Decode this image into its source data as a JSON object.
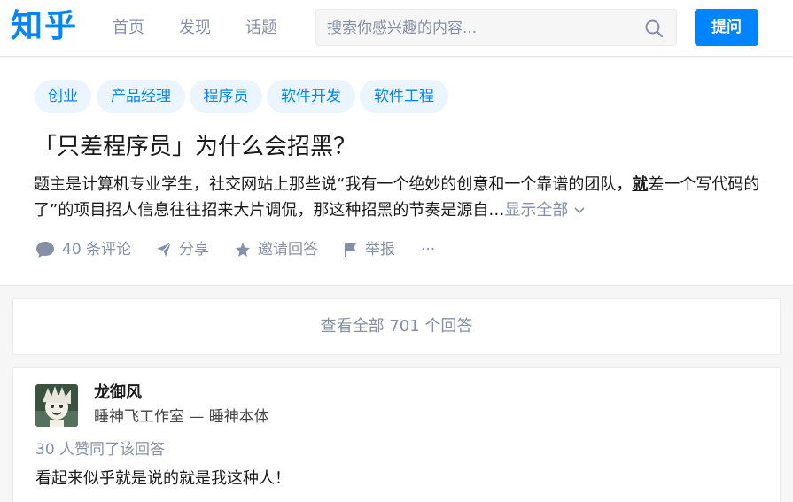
{
  "header": {
    "logo": "知乎",
    "nav": [
      "首页",
      "发现",
      "话题"
    ],
    "search_placeholder": "搜索你感兴趣的内容...",
    "ask_label": "提问",
    "accent_color": "#0084ff"
  },
  "question": {
    "topics": [
      "创业",
      "产品经理",
      "程序员",
      "软件开发",
      "软件工程"
    ],
    "title": "「只差程序员」为什么会招黑？",
    "desc_part1": "题主是计算机专业学生，社交网站上那些说“我有一个绝妙的创意和一个靠谱的团队，",
    "desc_highlight": "就",
    "desc_part2": "差一个写代码的了”的项目招人信息往往招来大片调侃，那这种招黑的节奏是源自…",
    "show_all": "显示全部",
    "actions": {
      "comments": "40 条评论",
      "share": "分享",
      "invite": "邀请回答",
      "report": "举报",
      "more": "···"
    }
  },
  "view_all": "查看全部 701 个回答",
  "answer": {
    "author": "龙御风",
    "bio": "睡神飞工作室 — 睡神本体",
    "votes": "30 人赞同了该回答",
    "content": "看起来似乎就是说的就是我这种人！"
  }
}
